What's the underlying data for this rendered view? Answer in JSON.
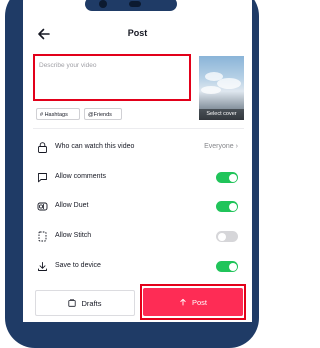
{
  "header": {
    "title": "Post"
  },
  "description": {
    "placeholder": "Describe your video"
  },
  "cover": {
    "label": "Select cover"
  },
  "tags": {
    "hashtags": "# Hashtags",
    "friends": "@Friends"
  },
  "settings": [
    {
      "label": "Who can watch this video",
      "value": "Everyone",
      "icon": "lock-icon"
    },
    {
      "label": "Allow comments",
      "on": true,
      "icon": "comment-icon"
    },
    {
      "label": "Allow Duet",
      "on": true,
      "icon": "duet-icon"
    },
    {
      "label": "Allow Stitch",
      "on": false,
      "icon": "stitch-icon"
    },
    {
      "label": "Save to device",
      "on": true,
      "icon": "download-icon"
    }
  ],
  "actions": {
    "drafts": "Drafts",
    "post": "Post"
  },
  "colors": {
    "accent": "#fe2c55",
    "toggle_on": "#20c45a",
    "highlight": "#e2001a",
    "phone": "#1f3b66"
  }
}
